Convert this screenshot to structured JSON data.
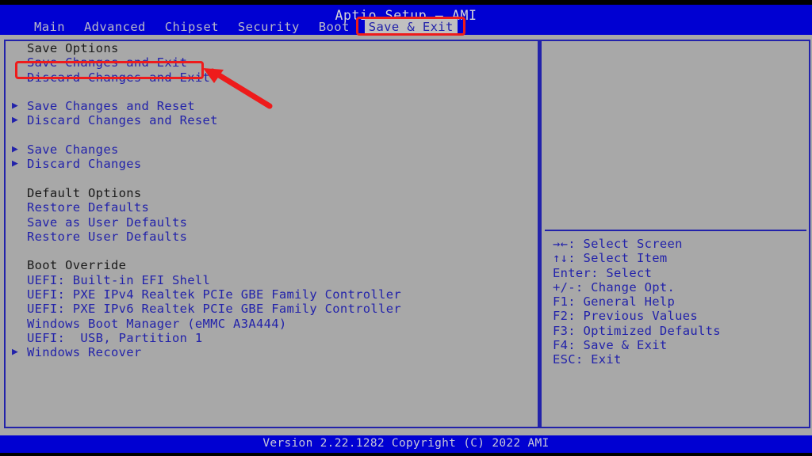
{
  "header": {
    "title": "Aptio Setup – AMI"
  },
  "menubar": {
    "items": [
      {
        "label": "Main",
        "active": false
      },
      {
        "label": "Advanced",
        "active": false
      },
      {
        "label": "Chipset",
        "active": false
      },
      {
        "label": "Security",
        "active": false
      },
      {
        "label": "Boot",
        "active": false
      },
      {
        "label": "Save & Exit",
        "active": true
      }
    ]
  },
  "main": {
    "rows": [
      {
        "label": "Save Options",
        "kind": "heading",
        "bullet": false
      },
      {
        "label": "Save Changes and Exit",
        "kind": "item",
        "bullet": false
      },
      {
        "label": "Discard Changes and Exit",
        "kind": "item",
        "bullet": false
      },
      {
        "label": "",
        "kind": "spacer",
        "bullet": false
      },
      {
        "label": "Save Changes and Reset",
        "kind": "item",
        "bullet": true
      },
      {
        "label": "Discard Changes and Reset",
        "kind": "item",
        "bullet": true
      },
      {
        "label": "",
        "kind": "spacer",
        "bullet": false
      },
      {
        "label": "Save Changes",
        "kind": "item",
        "bullet": true
      },
      {
        "label": "Discard Changes",
        "kind": "item",
        "bullet": true
      },
      {
        "label": "",
        "kind": "spacer",
        "bullet": false
      },
      {
        "label": "Default Options",
        "kind": "heading",
        "bullet": false
      },
      {
        "label": "Restore Defaults",
        "kind": "item",
        "bullet": false
      },
      {
        "label": "Save as User Defaults",
        "kind": "item",
        "bullet": false
      },
      {
        "label": "Restore User Defaults",
        "kind": "item",
        "bullet": false
      },
      {
        "label": "",
        "kind": "spacer",
        "bullet": false
      },
      {
        "label": "Boot Override",
        "kind": "heading",
        "bullet": false
      },
      {
        "label": "UEFI: Built-in EFI Shell",
        "kind": "item",
        "bullet": false
      },
      {
        "label": "UEFI: PXE IPv4 Realtek PCIe GBE Family Controller",
        "kind": "item",
        "bullet": false
      },
      {
        "label": "UEFI: PXE IPv6 Realtek PCIe GBE Family Controller",
        "kind": "item",
        "bullet": false
      },
      {
        "label": "Windows Boot Manager (eMMC A3A444)",
        "kind": "item",
        "bullet": false
      },
      {
        "label": "UEFI:  USB, Partition 1",
        "kind": "item",
        "bullet": false
      },
      {
        "label": "Windows Recover",
        "kind": "item",
        "bullet": true
      }
    ]
  },
  "help": {
    "legend": [
      "→←: Select Screen",
      "↑↓: Select Item",
      "Enter: Select",
      "+/-: Change Opt.",
      "F1: General Help",
      "F2: Previous Values",
      "F3: Optimized Defaults",
      "F4: Save & Exit",
      "ESC: Exit"
    ]
  },
  "footer": {
    "version_text": "Version 2.22.1282 Copyright (C) 2022 AMI"
  },
  "annotations": {
    "tab_highlight_label": "Save & Exit",
    "item_highlight_label": "Save Changes and Exit",
    "accent_color": "#ee1b1b"
  },
  "colors": {
    "background_blue": "#0000d2",
    "panel_gray": "#a8a8a8",
    "text_blue": "#2222aa",
    "heading_dark": "#1a1a1a"
  }
}
